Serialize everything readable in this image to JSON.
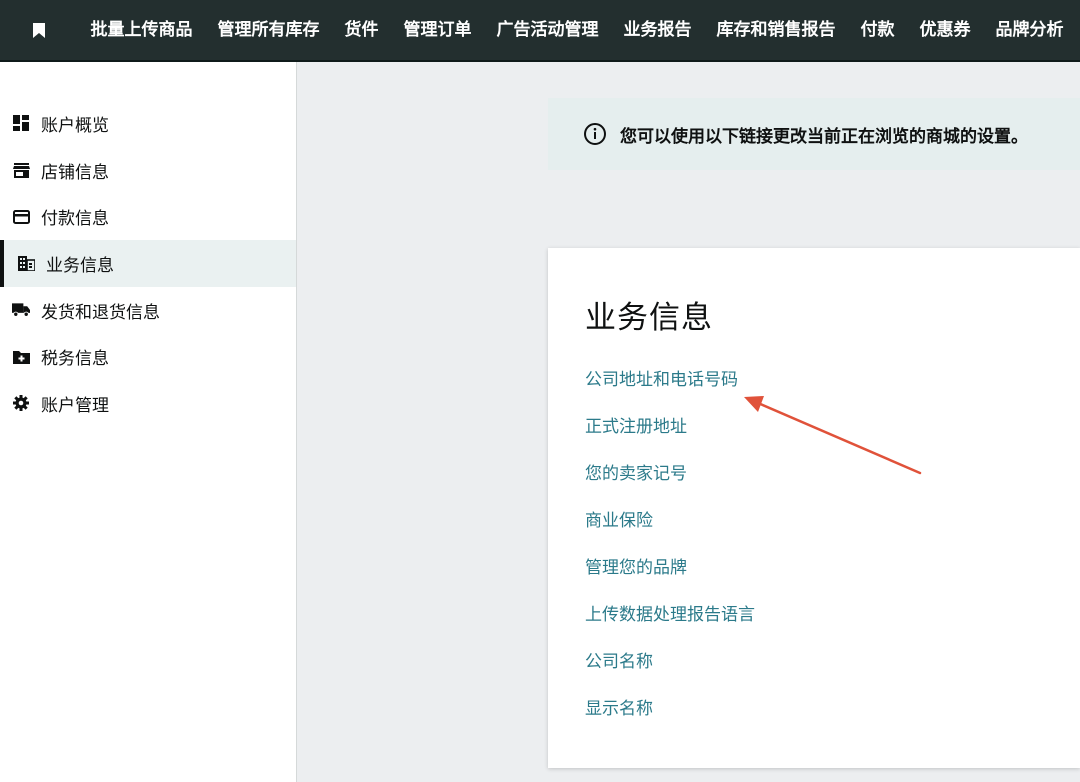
{
  "topnav": {
    "items": [
      "批量上传商品",
      "管理所有库存",
      "货件",
      "管理订单",
      "广告活动管理",
      "业务报告",
      "库存和销售报告",
      "付款",
      "优惠券",
      "品牌分析"
    ]
  },
  "sidebar": {
    "items": [
      {
        "label": "账户概览",
        "icon": "dashboard-icon"
      },
      {
        "label": "店铺信息",
        "icon": "store-icon"
      },
      {
        "label": "付款信息",
        "icon": "credit-card-icon"
      },
      {
        "label": "业务信息",
        "icon": "building-icon",
        "active": true
      },
      {
        "label": "发货和退货信息",
        "icon": "truck-icon"
      },
      {
        "label": "税务信息",
        "icon": "folder-plus-icon"
      },
      {
        "label": "账户管理",
        "icon": "gear-icon"
      }
    ]
  },
  "notice": {
    "text": "您可以使用以下链接更改当前正在浏览的商城的设置。",
    "icon": "info-icon"
  },
  "card": {
    "title": "业务信息",
    "links": [
      "公司地址和电话号码",
      "正式注册地址",
      "您的卖家记号",
      "商业保险",
      "管理您的品牌",
      "上传数据处理报告语言",
      "公司名称",
      "显示名称"
    ]
  },
  "annotation": {
    "color": "#e0523a"
  },
  "colors": {
    "topbar": "#232f2f",
    "link": "#2b7a8a",
    "active_bg": "#eaf1f1",
    "notice_bg": "#e5eeee"
  }
}
